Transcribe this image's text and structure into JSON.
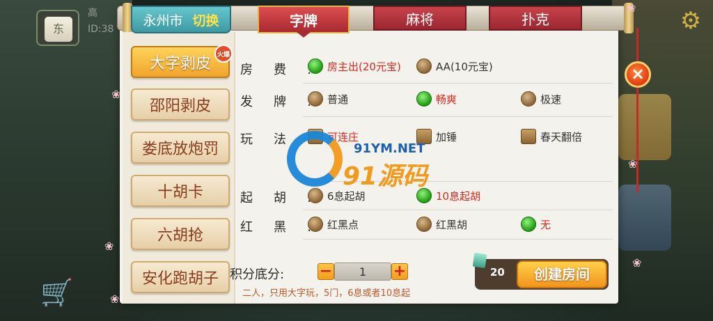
{
  "background": {
    "avatar_tile_char": "东",
    "name_partial": "高",
    "id_partial": "ID:38"
  },
  "header": {
    "city": "永州市",
    "switch_label": "切换",
    "tabs": [
      {
        "label": "字牌",
        "active": true
      },
      {
        "label": "麻将",
        "active": false
      },
      {
        "label": "扑克",
        "active": false
      }
    ]
  },
  "games": [
    {
      "label": "大字剥皮",
      "active": true,
      "badge": "火爆"
    },
    {
      "label": "邵阳剥皮",
      "active": false
    },
    {
      "label": "娄底放炮罚",
      "active": false
    },
    {
      "label": "十胡卡",
      "active": false
    },
    {
      "label": "六胡抢",
      "active": false
    },
    {
      "label": "安化跑胡子",
      "active": false
    }
  ],
  "rows": {
    "fee": {
      "label": "房费:",
      "options": [
        {
          "text": "房主出(20元宝)",
          "selected": true
        },
        {
          "text": "AA(10元宝)",
          "selected": false
        }
      ]
    },
    "deal": {
      "label": "发牌:",
      "options": [
        {
          "text": "普通",
          "selected": false
        },
        {
          "text": "畅爽",
          "selected": true
        },
        {
          "text": "极速",
          "selected": false
        }
      ]
    },
    "play": {
      "label": "玩法:",
      "options": [
        {
          "text": "可连庄",
          "selected": true
        },
        {
          "text": "加锤",
          "selected": false
        },
        {
          "text": "春天翻倍",
          "selected": false
        }
      ]
    },
    "hu": {
      "label": "起胡:",
      "options": [
        {
          "text": "6息起胡",
          "selected": false
        },
        {
          "text": "10息起胡",
          "selected": true
        }
      ]
    },
    "redblack": {
      "label": "红黑:",
      "options": [
        {
          "text": "红黑点",
          "selected": false
        },
        {
          "text": "红黑胡",
          "selected": false
        },
        {
          "text": "无",
          "selected": true
        }
      ]
    }
  },
  "score": {
    "label": "积分底分:",
    "minus": "−",
    "value": "1",
    "plus": "+",
    "hint": "二人，只用大字玩，5门，6息或者10息起"
  },
  "create": {
    "count": "20",
    "label": "创建房间"
  },
  "close_icon": "×",
  "settings_icon": "⚙",
  "watermark": {
    "url": "91YM.NET",
    "name": "91源码"
  }
}
